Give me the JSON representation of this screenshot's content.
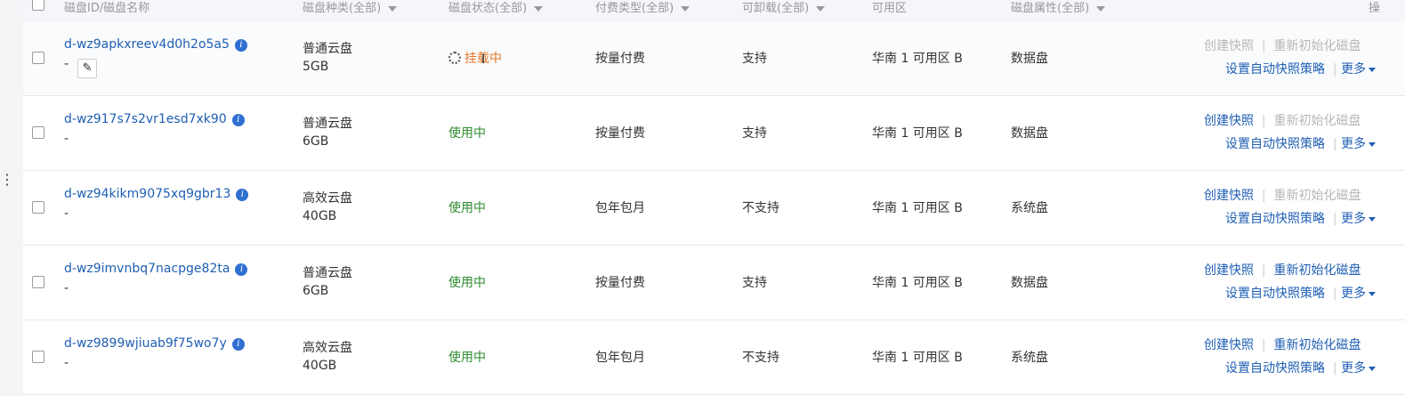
{
  "header": {
    "checkbox": "",
    "disk_id_name": "磁盘ID/磁盘名称",
    "disk_type": "磁盘种类(全部)",
    "disk_status": "磁盘状态(全部)",
    "billing_type": "付费类型(全部)",
    "detachable": "可卸载(全部)",
    "zone": "可用区",
    "disk_attr": "磁盘属性(全部)",
    "ops": "操"
  },
  "rows": [
    {
      "id": "d-wz9apkxreev4d0h2o5a5",
      "name": "-",
      "kind": "普通云盘",
      "size": "5GB",
      "status": "挂载中",
      "status_type": "busy",
      "billing": "按量付费",
      "detachable": "支持",
      "zone": "华南 1 可用区 B",
      "attr": "数据盘",
      "op_snapshot": "创建快照",
      "op_snapshot_disabled": true,
      "op_reinit": "重新初始化磁盘",
      "op_reinit_disabled": true,
      "op_policy": "设置自动快照策略",
      "op_more": "更多"
    },
    {
      "id": "d-wz917s7s2vr1esd7xk90",
      "name": "-",
      "kind": "普通云盘",
      "size": "6GB",
      "status": "使用中",
      "status_type": "ok",
      "billing": "按量付费",
      "detachable": "支持",
      "zone": "华南 1 可用区 B",
      "attr": "数据盘",
      "op_snapshot": "创建快照",
      "op_snapshot_disabled": false,
      "op_reinit": "重新初始化磁盘",
      "op_reinit_disabled": true,
      "op_policy": "设置自动快照策略",
      "op_more": "更多"
    },
    {
      "id": "d-wz94kikm9075xq9gbr13",
      "name": "-",
      "kind": "高效云盘",
      "size": "40GB",
      "status": "使用中",
      "status_type": "ok",
      "billing": "包年包月",
      "detachable": "不支持",
      "zone": "华南 1 可用区 B",
      "attr": "系统盘",
      "op_snapshot": "创建快照",
      "op_snapshot_disabled": false,
      "op_reinit": "重新初始化磁盘",
      "op_reinit_disabled": true,
      "op_policy": "设置自动快照策略",
      "op_more": "更多"
    },
    {
      "id": "d-wz9imvnbq7nacpge82ta",
      "name": "-",
      "kind": "普通云盘",
      "size": "6GB",
      "status": "使用中",
      "status_type": "ok",
      "billing": "按量付费",
      "detachable": "支持",
      "zone": "华南 1 可用区 B",
      "attr": "数据盘",
      "op_snapshot": "创建快照",
      "op_snapshot_disabled": false,
      "op_reinit": "重新初始化磁盘",
      "op_reinit_disabled": false,
      "op_policy": "设置自动快照策略",
      "op_more": "更多"
    },
    {
      "id": "d-wz9899wjiuab9f75wo7y",
      "name": "-",
      "kind": "高效云盘",
      "size": "40GB",
      "status": "使用中",
      "status_type": "ok",
      "billing": "包年包月",
      "detachable": "不支持",
      "zone": "华南 1 可用区 B",
      "attr": "系统盘",
      "op_snapshot": "创建快照",
      "op_snapshot_disabled": false,
      "op_reinit": "重新初始化磁盘",
      "op_reinit_disabled": false,
      "op_policy": "设置自动快照策略",
      "op_more": "更多"
    }
  ],
  "colors": {
    "link": "#1f5fb3",
    "status_ok": "#2e8a2e",
    "status_busy": "#e3792b",
    "disabled": "#b7b7b7",
    "header_bg": "#f5f6fa"
  },
  "icons": {
    "info": "info-icon",
    "edit": "pencil-icon",
    "more": "chevron-down-icon",
    "loading": "loading-spinner-icon"
  }
}
